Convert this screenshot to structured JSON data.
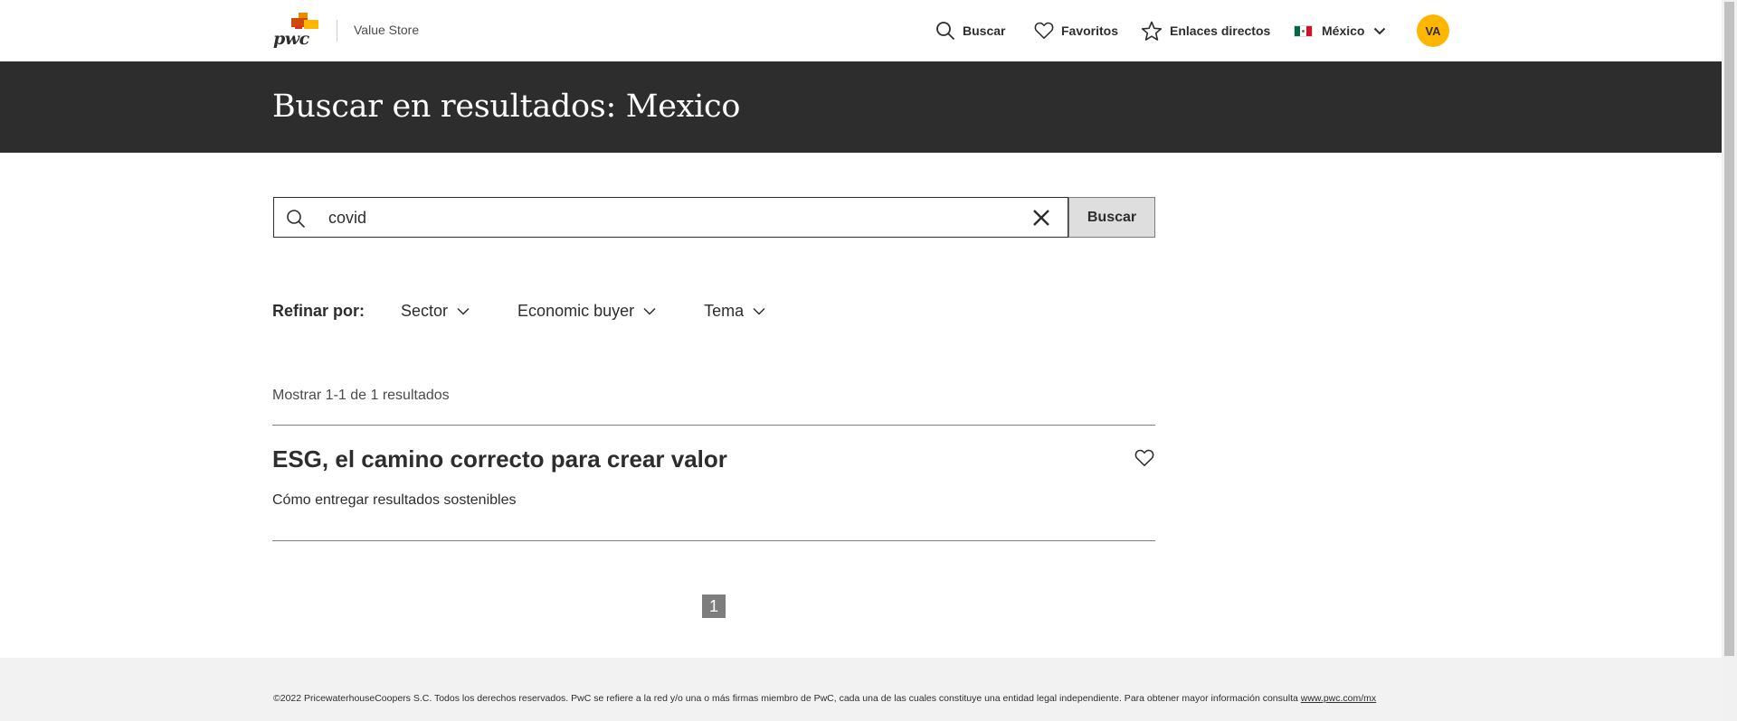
{
  "header": {
    "logo_text": "pwc",
    "app_name": "Value Store",
    "nav": {
      "search": "Buscar",
      "favorites": "Favoritos",
      "shortcuts": "Enlaces directos",
      "country": "México"
    },
    "avatar_initials": "VA"
  },
  "banner": {
    "title": "Buscar en resultados: Mexico"
  },
  "search": {
    "value": "covid",
    "button_label": "Buscar"
  },
  "refine": {
    "label": "Refinar por:",
    "filters": [
      "Sector",
      "Economic buyer",
      "Tema"
    ]
  },
  "results": {
    "count_text": "Mostrar 1-1 de 1 resultados",
    "items": [
      {
        "title": "ESG, el camino correcto para crear valor",
        "description": "Cómo entregar resultados sostenibles"
      }
    ]
  },
  "pagination": {
    "current": "1"
  },
  "footer": {
    "text": "©2022 PricewaterhouseCoopers S.C. Todos los derechos reservados. PwC se refiere a la red y/o una o más firmas miembro de PwC, cada una de las cuales constituye una entidad legal independiente. Para obtener mayor información consulta ",
    "link": "www.pwc.com/mx"
  },
  "colors": {
    "banner_bg": "#2d2d2d",
    "avatar_bg": "#ffb600",
    "logo_orange": "#d04a02",
    "page_active": "#7d7d7d"
  }
}
